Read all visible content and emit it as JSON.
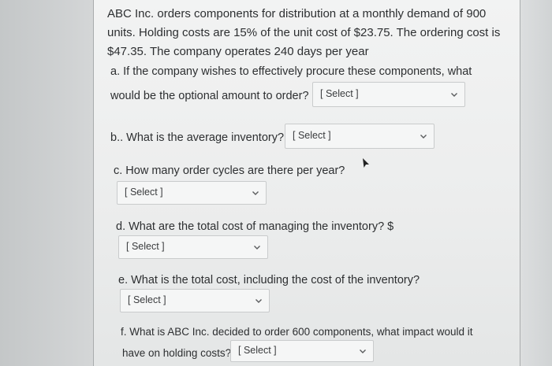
{
  "intro": {
    "line1": "ABC Inc. orders components for distribution at a monthly demand of 900",
    "line2": "units. Holding costs are 15% of the unit cost of $23.75. The ordering cost is",
    "line3": "$47.35. The company operates 240 days per year"
  },
  "questions": {
    "a_line1": "a. If the company wishes to effectively procure these components, what",
    "a_line2": "would be the optional amount to order?",
    "b": "b.. What is the average inventory?",
    "c": "c. How many order cycles are there per year?",
    "d": "d. What are the total cost of managing the inventory? $",
    "e": "e. What is the total cost, including the cost of the inventory?",
    "f_line1": "f. What is ABC Inc. decided to order 600 components, what impact would it",
    "f_line2": "have on holding costs?"
  },
  "selects": {
    "a": "[ Select ]",
    "b": "[ Select ]",
    "c": "[ Select ]",
    "d": "[ Select ]",
    "e": "[ Select ]",
    "f": "[ Select ]"
  },
  "icons": {
    "dropdown": "chevron-down-icon",
    "cursor": "mouse-pointer-icon"
  }
}
